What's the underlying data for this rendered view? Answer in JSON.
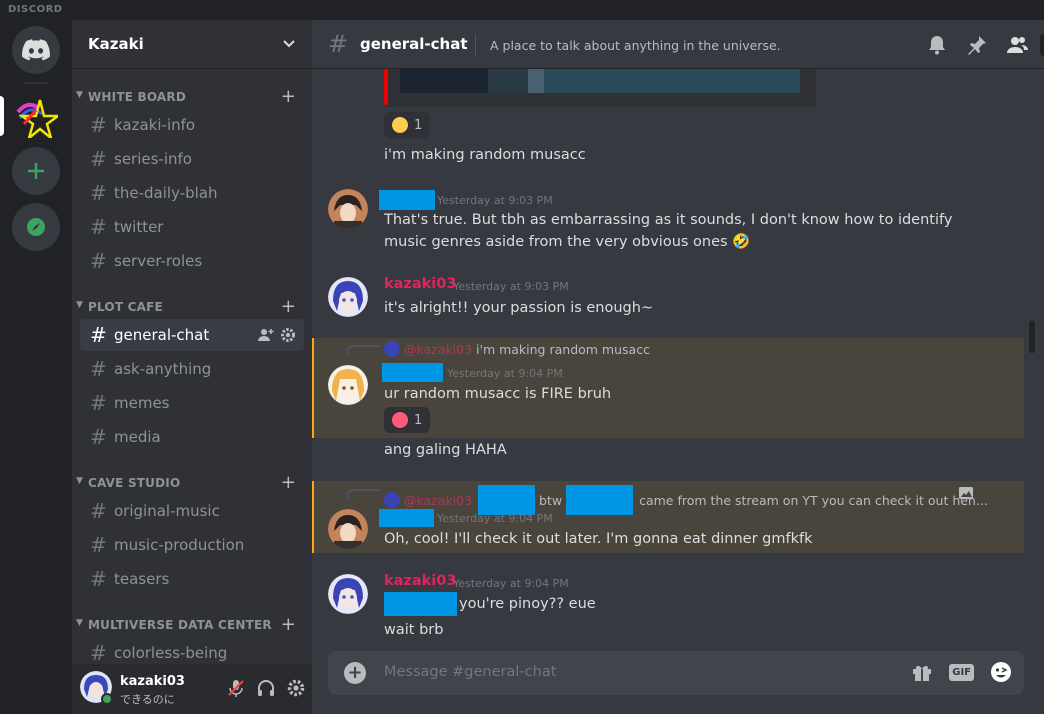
{
  "titlebar": {
    "brand": "DISCORD"
  },
  "guild": {
    "name": "Kazaki"
  },
  "sidebar": {
    "categories": [
      {
        "name": "WHITE BOARD",
        "channels": [
          "kazaki-info",
          "series-info",
          "the-daily-blah",
          "twitter",
          "server-roles"
        ]
      },
      {
        "name": "PLOT CAFE",
        "channels": [
          "general-chat",
          "ask-anything",
          "memes",
          "media"
        ]
      },
      {
        "name": "CAVE STUDIO",
        "channels": [
          "original-music",
          "music-production",
          "teasers"
        ]
      },
      {
        "name": "MULTIVERSE DATA CENTER",
        "channels": [
          "colorless-being"
        ]
      }
    ],
    "active_channel": "general-chat"
  },
  "user": {
    "name": "kazaki03",
    "status": "できるのに"
  },
  "header": {
    "channel": "general-chat",
    "topic": "A place to talk about anything in the universe."
  },
  "messages": {
    "m0": {
      "reaction_count": "1",
      "text": "i'm making random musacc"
    },
    "m1": {
      "timestamp": "Yesterday at 9:03 PM",
      "text": "That's true. But tbh as embarrassing as it sounds, I don't know how to identify music genres aside from the very obvious ones 🤣"
    },
    "m2": {
      "author": "kazaki03",
      "timestamp": "Yesterday at 9:03 PM",
      "text": "it's alright!! your passion is enough~"
    },
    "m3": {
      "reply_author": "@kazaki03",
      "reply_text": "i'm making random musacc",
      "timestamp": "Yesterday at 9:04 PM",
      "text": "ur random musacc is FIRE bruh",
      "reaction_count": "1",
      "followup": "ang galing HAHA"
    },
    "m4": {
      "reply_author": "@kazaki03",
      "reply_mid": "btw",
      "reply_text": "came from the stream on YT you can check it out heh...",
      "timestamp": "Yesterday at 9:04 PM",
      "text": "Oh, cool! I'll check it out later. I'm gonna eat dinner gmfkfk"
    },
    "m5": {
      "author": "kazaki03",
      "timestamp": "Yesterday at 9:04 PM",
      "text": "you're pinoy?? eue",
      "followup": "wait brb"
    }
  },
  "composer": {
    "placeholder": "Message #general-chat",
    "gif_label": "GIF"
  },
  "colors": {
    "accent": "#5865f2",
    "mention_author": "#e0245e",
    "redaction": "#0096e6",
    "highlight_border": "#faa81a"
  },
  "icons": [
    "discord-logo-icon",
    "add-server-icon",
    "explore-icon",
    "bell-icon",
    "pin-icon",
    "members-icon",
    "mic-muted-icon",
    "headphones-icon",
    "gear-icon",
    "gift-icon",
    "gif-icon",
    "emoji-icon",
    "image-icon"
  ]
}
